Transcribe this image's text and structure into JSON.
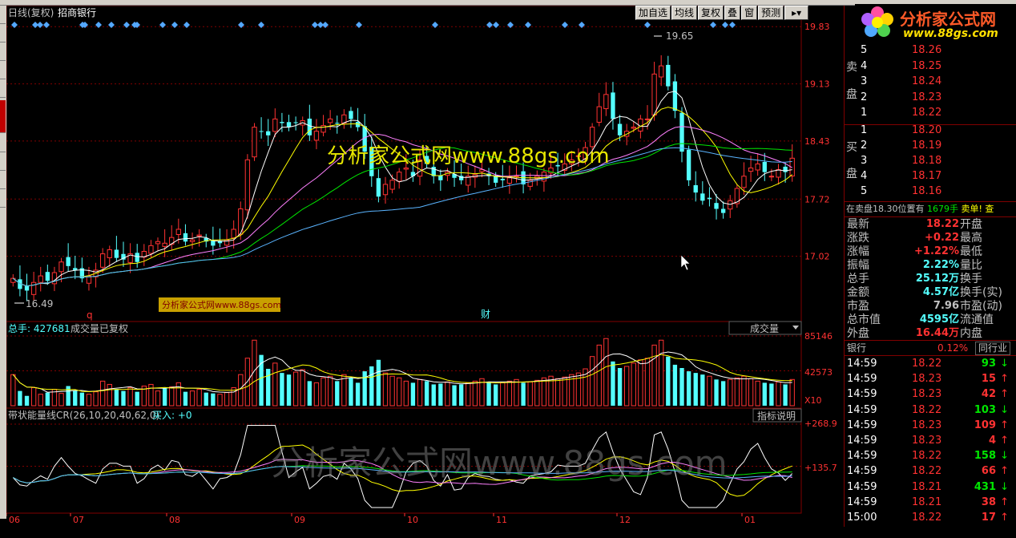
{
  "header": {
    "period": "日线(复权)",
    "stock_name": "招商银行",
    "toolbar": [
      "加自选",
      "均线",
      "复权",
      "叠",
      "窗",
      "预测"
    ]
  },
  "price_axis": [
    "19.83",
    "19.13",
    "18.43",
    "17.72",
    "17.02"
  ],
  "annotations": {
    "high_label": "19.65",
    "low_label": "16.49",
    "marker_q": "q",
    "marker_cai": "财"
  },
  "watermark_main": "分析家公式网www.88gs.com",
  "watermark_box": "分析家公式网www.88gs.com",
  "watermark_bottom": "分析家公式网www.88gs.com",
  "volume_panel": {
    "title": "总手: 427681",
    "subtitle": "成交量已复权",
    "dropdown": "成交量",
    "axis": [
      "85146",
      "42573"
    ],
    "unit": "X10"
  },
  "indicator_panel": {
    "title": "带状能量线CR(26,10,20,40,62,0)",
    "buy": "买入: +0",
    "button": "指标说明",
    "axis": [
      "+268.9",
      "+135.7"
    ]
  },
  "x_axis": [
    "06",
    "07",
    "08",
    "09",
    "10",
    "11",
    "12",
    "01"
  ],
  "logo": {
    "text": "分析家公式网",
    "url": "www.88gs.com"
  },
  "order_book": {
    "sell_label": [
      "卖",
      "盘"
    ],
    "buy_label": [
      "买",
      "盘"
    ],
    "sells": [
      {
        "n": "5",
        "p": "18.26"
      },
      {
        "n": "4",
        "p": "18.25"
      },
      {
        "n": "3",
        "p": "18.24"
      },
      {
        "n": "2",
        "p": "18.23"
      },
      {
        "n": "1",
        "p": "18.22"
      }
    ],
    "buys": [
      {
        "n": "1",
        "p": "18.20"
      },
      {
        "n": "2",
        "p": "18.19"
      },
      {
        "n": "3",
        "p": "18.18"
      },
      {
        "n": "4",
        "p": "18.17"
      },
      {
        "n": "5",
        "p": "18.16"
      }
    ],
    "note_a": "在卖盘18.30位置有",
    "note_b": "1679手",
    "note_c": "卖单! 查"
  },
  "quote": [
    {
      "l": "最新",
      "v": "18.22",
      "c": "red",
      "r": "开盘"
    },
    {
      "l": "涨跌",
      "v": "+0.22",
      "c": "red",
      "r": "最高"
    },
    {
      "l": "涨幅",
      "v": "+1.22%",
      "c": "red",
      "r": "最低"
    },
    {
      "l": "振幅",
      "v": "2.22%",
      "c": "cyan",
      "r": "量比"
    },
    {
      "l": "总手",
      "v": "25.12万",
      "c": "cyan",
      "r": "换手"
    },
    {
      "l": "金额",
      "v": "4.57亿",
      "c": "cyan",
      "r": "换手(实)"
    },
    {
      "l": "市盈",
      "v": "7.96",
      "c": "lbl",
      "r": "市盈(动)"
    },
    {
      "l": "总市值",
      "v": "4595亿",
      "c": "cyan",
      "r": "流通值"
    },
    {
      "l": "外盘",
      "v": "16.44万",
      "c": "red",
      "r": "内盘"
    }
  ],
  "industry": {
    "name": "银行",
    "pct": "0.12%",
    "button": "同行业"
  },
  "ticks": [
    {
      "t": "14:59",
      "p": "18.22",
      "pc": "red",
      "v": "93",
      "d": "down"
    },
    {
      "t": "14:59",
      "p": "18.23",
      "pc": "red",
      "v": "15",
      "d": "up"
    },
    {
      "t": "14:59",
      "p": "18.23",
      "pc": "red",
      "v": "42",
      "d": "up"
    },
    {
      "t": "14:59",
      "p": "18.22",
      "pc": "red",
      "v": "103",
      "d": "down"
    },
    {
      "t": "14:59",
      "p": "18.23",
      "pc": "red",
      "v": "109",
      "d": "up"
    },
    {
      "t": "14:59",
      "p": "18.23",
      "pc": "red",
      "v": "4",
      "d": "up"
    },
    {
      "t": "14:59",
      "p": "18.22",
      "pc": "red",
      "v": "158",
      "d": "down"
    },
    {
      "t": "14:59",
      "p": "18.22",
      "pc": "red",
      "v": "66",
      "d": "up"
    },
    {
      "t": "14:59",
      "p": "18.21",
      "pc": "red",
      "v": "431",
      "d": "down"
    },
    {
      "t": "14:59",
      "p": "18.21",
      "pc": "red",
      "v": "38",
      "d": "up"
    },
    {
      "t": "15:00",
      "p": "18.22",
      "pc": "red",
      "v": "17",
      "d": "up"
    }
  ],
  "chart_data": {
    "type": "candlestick",
    "ylim": [
      16.3,
      19.95
    ],
    "volume_max": 85146,
    "cr_range": [
      0,
      268.9
    ],
    "closes": [
      16.75,
      16.62,
      16.6,
      16.7,
      16.78,
      16.72,
      16.82,
      16.95,
      16.9,
      16.85,
      16.75,
      16.78,
      16.85,
      17.05,
      17.1,
      17.0,
      16.98,
      17.05,
      16.95,
      17.08,
      17.15,
      17.2,
      17.18,
      17.25,
      17.35,
      17.2,
      17.22,
      17.28,
      17.2,
      17.15,
      17.18,
      17.22,
      17.35,
      17.6,
      18.2,
      18.6,
      18.55,
      18.5,
      18.7,
      18.65,
      18.6,
      18.65,
      18.68,
      18.5,
      18.55,
      18.62,
      18.7,
      18.65,
      18.75,
      18.7,
      18.6,
      18.3,
      18.0,
      17.75,
      17.9,
      17.95,
      18.05,
      18.1,
      18.0,
      18.2,
      18.15,
      18.0,
      17.95,
      18.05,
      17.98,
      17.95,
      18.0,
      18.02,
      18.08,
      18.0,
      17.92,
      17.95,
      17.98,
      18.0,
      17.9,
      17.95,
      18.0,
      18.05,
      18.1,
      18.12,
      18.15,
      18.2,
      18.25,
      18.35,
      18.6,
      18.85,
      19.0,
      18.7,
      18.5,
      18.55,
      18.6,
      18.7,
      18.7,
      19.25,
      19.35,
      19.1,
      18.8,
      18.3,
      17.95,
      17.8,
      17.7,
      17.72,
      17.6,
      17.55,
      17.7,
      17.85,
      18.0,
      18.1,
      18.15,
      18.05,
      18.0,
      18.08,
      18.05,
      18.22
    ],
    "volumes": [
      38000,
      18000,
      12000,
      22000,
      14000,
      16000,
      20000,
      15000,
      24000,
      18000,
      16000,
      14000,
      17000,
      30000,
      26000,
      20000,
      18000,
      22000,
      17000,
      24000,
      26000,
      18000,
      21000,
      23000,
      28000,
      17000,
      18000,
      20000,
      16000,
      15000,
      14000,
      16000,
      22000,
      38000,
      58000,
      80000,
      62000,
      45000,
      52000,
      40000,
      38000,
      41000,
      44000,
      30000,
      28000,
      34000,
      36000,
      30000,
      38000,
      34000,
      28000,
      42000,
      48000,
      56000,
      40000,
      36000,
      34000,
      30000,
      28000,
      32000,
      30000,
      26000,
      27000,
      29000,
      25000,
      26000,
      28000,
      30000,
      33000,
      29000,
      26000,
      28000,
      30000,
      32000,
      28000,
      29000,
      31000,
      34000,
      36000,
      33000,
      35000,
      38000,
      40000,
      45000,
      60000,
      74000,
      82000,
      54000,
      46000,
      48000,
      52000,
      56000,
      58000,
      74000,
      80000,
      60000,
      50000,
      46000,
      42000,
      40000,
      38000,
      36000,
      32000,
      30000,
      32000,
      34000,
      36000,
      33000,
      30000,
      28000,
      27000,
      29000,
      26000,
      32000
    ],
    "ma_series": [
      {
        "color": "#ffffff",
        "n": 5
      },
      {
        "color": "#ffff00",
        "n": 10
      },
      {
        "color": "#ff80ff",
        "n": 20
      },
      {
        "color": "#00e600",
        "n": 30
      },
      {
        "color": "#5ab4ff",
        "n": 60
      }
    ],
    "x_ticks": [
      "06",
      "07",
      "08",
      "09",
      "10",
      "11",
      "12",
      "01"
    ]
  }
}
